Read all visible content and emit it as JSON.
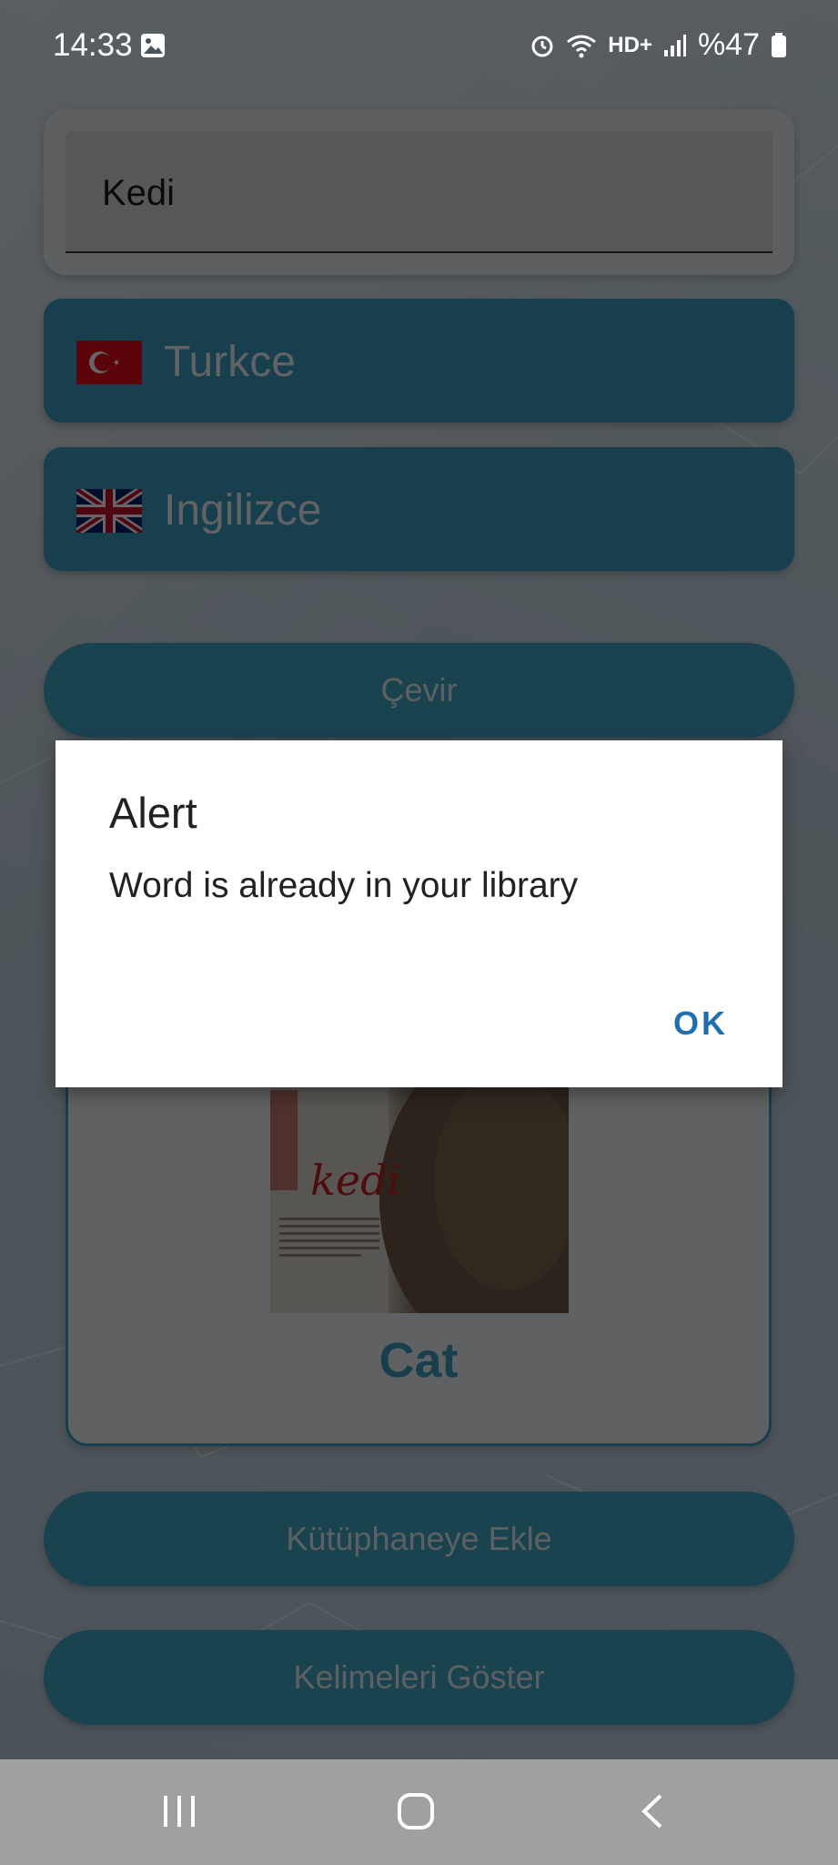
{
  "status_bar": {
    "time": "14:33",
    "battery_text": "%47",
    "network_label": "HD+"
  },
  "input": {
    "value": "Kedi"
  },
  "languages": {
    "source": {
      "label": "Turkce",
      "flag": "turkey-flag"
    },
    "target": {
      "label": "Ingilizce",
      "flag": "uk-flag"
    }
  },
  "buttons": {
    "translate": "Çevir",
    "add_to_library": "Kütüphaneye Ekle",
    "show_words": "Kelimeleri Göster"
  },
  "result": {
    "word": "Cat",
    "poster_title": "kedi"
  },
  "dialog": {
    "title": "Alert",
    "message": "Word is already in your library",
    "ok_label": "OK"
  },
  "colors": {
    "accent": "#3a9fc4",
    "dialog_button": "#1f6fb0"
  }
}
